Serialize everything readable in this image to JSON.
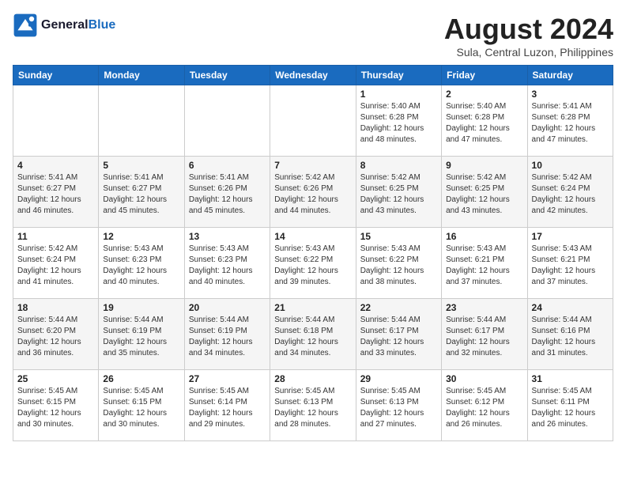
{
  "logo": {
    "line1": "General",
    "line2": "Blue"
  },
  "title": "August 2024",
  "location": "Sula, Central Luzon, Philippines",
  "weekdays": [
    "Sunday",
    "Monday",
    "Tuesday",
    "Wednesday",
    "Thursday",
    "Friday",
    "Saturday"
  ],
  "weeks": [
    [
      {
        "day": "",
        "info": ""
      },
      {
        "day": "",
        "info": ""
      },
      {
        "day": "",
        "info": ""
      },
      {
        "day": "",
        "info": ""
      },
      {
        "day": "1",
        "info": "Sunrise: 5:40 AM\nSunset: 6:28 PM\nDaylight: 12 hours\nand 48 minutes."
      },
      {
        "day": "2",
        "info": "Sunrise: 5:40 AM\nSunset: 6:28 PM\nDaylight: 12 hours\nand 47 minutes."
      },
      {
        "day": "3",
        "info": "Sunrise: 5:41 AM\nSunset: 6:28 PM\nDaylight: 12 hours\nand 47 minutes."
      }
    ],
    [
      {
        "day": "4",
        "info": "Sunrise: 5:41 AM\nSunset: 6:27 PM\nDaylight: 12 hours\nand 46 minutes."
      },
      {
        "day": "5",
        "info": "Sunrise: 5:41 AM\nSunset: 6:27 PM\nDaylight: 12 hours\nand 45 minutes."
      },
      {
        "day": "6",
        "info": "Sunrise: 5:41 AM\nSunset: 6:26 PM\nDaylight: 12 hours\nand 45 minutes."
      },
      {
        "day": "7",
        "info": "Sunrise: 5:42 AM\nSunset: 6:26 PM\nDaylight: 12 hours\nand 44 minutes."
      },
      {
        "day": "8",
        "info": "Sunrise: 5:42 AM\nSunset: 6:25 PM\nDaylight: 12 hours\nand 43 minutes."
      },
      {
        "day": "9",
        "info": "Sunrise: 5:42 AM\nSunset: 6:25 PM\nDaylight: 12 hours\nand 43 minutes."
      },
      {
        "day": "10",
        "info": "Sunrise: 5:42 AM\nSunset: 6:24 PM\nDaylight: 12 hours\nand 42 minutes."
      }
    ],
    [
      {
        "day": "11",
        "info": "Sunrise: 5:42 AM\nSunset: 6:24 PM\nDaylight: 12 hours\nand 41 minutes."
      },
      {
        "day": "12",
        "info": "Sunrise: 5:43 AM\nSunset: 6:23 PM\nDaylight: 12 hours\nand 40 minutes."
      },
      {
        "day": "13",
        "info": "Sunrise: 5:43 AM\nSunset: 6:23 PM\nDaylight: 12 hours\nand 40 minutes."
      },
      {
        "day": "14",
        "info": "Sunrise: 5:43 AM\nSunset: 6:22 PM\nDaylight: 12 hours\nand 39 minutes."
      },
      {
        "day": "15",
        "info": "Sunrise: 5:43 AM\nSunset: 6:22 PM\nDaylight: 12 hours\nand 38 minutes."
      },
      {
        "day": "16",
        "info": "Sunrise: 5:43 AM\nSunset: 6:21 PM\nDaylight: 12 hours\nand 37 minutes."
      },
      {
        "day": "17",
        "info": "Sunrise: 5:43 AM\nSunset: 6:21 PM\nDaylight: 12 hours\nand 37 minutes."
      }
    ],
    [
      {
        "day": "18",
        "info": "Sunrise: 5:44 AM\nSunset: 6:20 PM\nDaylight: 12 hours\nand 36 minutes."
      },
      {
        "day": "19",
        "info": "Sunrise: 5:44 AM\nSunset: 6:19 PM\nDaylight: 12 hours\nand 35 minutes."
      },
      {
        "day": "20",
        "info": "Sunrise: 5:44 AM\nSunset: 6:19 PM\nDaylight: 12 hours\nand 34 minutes."
      },
      {
        "day": "21",
        "info": "Sunrise: 5:44 AM\nSunset: 6:18 PM\nDaylight: 12 hours\nand 34 minutes."
      },
      {
        "day": "22",
        "info": "Sunrise: 5:44 AM\nSunset: 6:17 PM\nDaylight: 12 hours\nand 33 minutes."
      },
      {
        "day": "23",
        "info": "Sunrise: 5:44 AM\nSunset: 6:17 PM\nDaylight: 12 hours\nand 32 minutes."
      },
      {
        "day": "24",
        "info": "Sunrise: 5:44 AM\nSunset: 6:16 PM\nDaylight: 12 hours\nand 31 minutes."
      }
    ],
    [
      {
        "day": "25",
        "info": "Sunrise: 5:45 AM\nSunset: 6:15 PM\nDaylight: 12 hours\nand 30 minutes."
      },
      {
        "day": "26",
        "info": "Sunrise: 5:45 AM\nSunset: 6:15 PM\nDaylight: 12 hours\nand 30 minutes."
      },
      {
        "day": "27",
        "info": "Sunrise: 5:45 AM\nSunset: 6:14 PM\nDaylight: 12 hours\nand 29 minutes."
      },
      {
        "day": "28",
        "info": "Sunrise: 5:45 AM\nSunset: 6:13 PM\nDaylight: 12 hours\nand 28 minutes."
      },
      {
        "day": "29",
        "info": "Sunrise: 5:45 AM\nSunset: 6:13 PM\nDaylight: 12 hours\nand 27 minutes."
      },
      {
        "day": "30",
        "info": "Sunrise: 5:45 AM\nSunset: 6:12 PM\nDaylight: 12 hours\nand 26 minutes."
      },
      {
        "day": "31",
        "info": "Sunrise: 5:45 AM\nSunset: 6:11 PM\nDaylight: 12 hours\nand 26 minutes."
      }
    ]
  ]
}
